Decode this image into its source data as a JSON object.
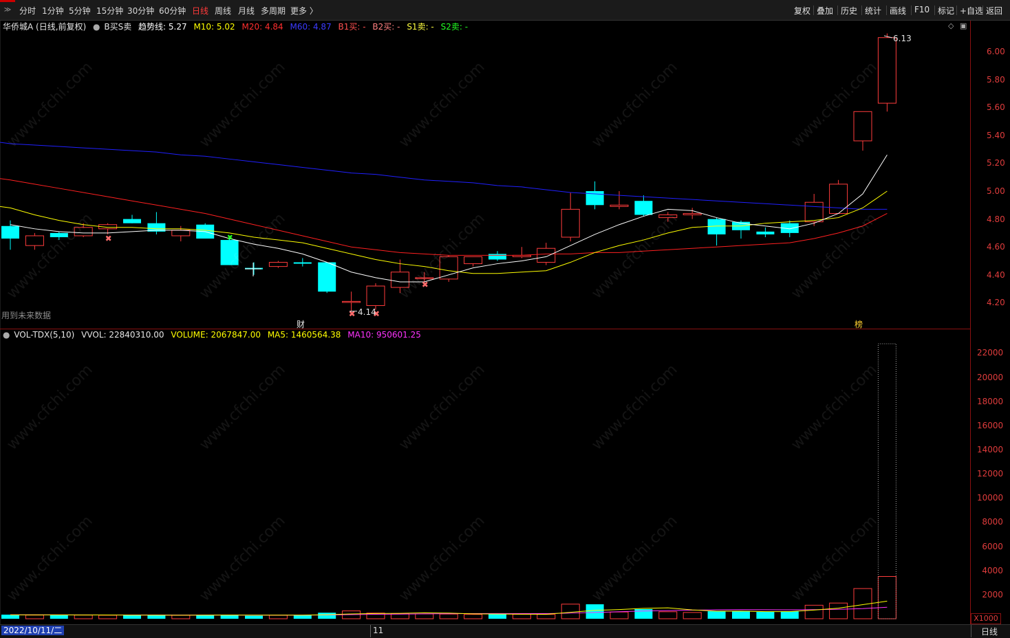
{
  "topbar": {
    "periods": [
      "分时",
      "1分钟",
      "5分钟",
      "15分钟",
      "30分钟",
      "60分钟",
      "日线",
      "周线",
      "月线",
      "多周期",
      "更多 〉"
    ],
    "active_period": "日线",
    "tools": [
      "复权",
      "叠加",
      "历史",
      "统计",
      "画线",
      "F10",
      "标记",
      "+自选",
      "返回"
    ]
  },
  "legend_main": {
    "stock": "华侨城A (日线,前复权)",
    "indicator": "B买S卖",
    "trend": "趋势线: 5.27",
    "m10": "M10: 5.02",
    "m20": "M20: 4.84",
    "m60": "M60: 4.87",
    "b1": "B1买: -",
    "b2": "B2买: -",
    "s1": "S1卖: -",
    "s2": "S2卖: -"
  },
  "legend_vol": {
    "name": "VOL-TDX(5,10)",
    "vvol": "VVOL: 22840310.00",
    "volume": "VOLUME: 2067847.00",
    "ma5": "MA5: 1460564.38",
    "ma10": "MA10: 950601.25"
  },
  "price_axis": [
    "6.00",
    "5.80",
    "5.60",
    "5.40",
    "5.20",
    "5.00",
    "4.80",
    "4.60",
    "4.40",
    "4.20"
  ],
  "vol_axis": [
    "22000",
    "20000",
    "18000",
    "16000",
    "14000",
    "12000",
    "10000",
    "8000",
    "6000",
    "4000",
    "2000"
  ],
  "vol_unit": "X1000",
  "annotations": {
    "high_label": "6.13",
    "low_label": "4.14",
    "cai_mark": "财",
    "bang_mark": "榜",
    "future_note": "用到未来数据"
  },
  "bottombar": {
    "date": "2022/10/11/二",
    "month": "11",
    "period_label": "日线"
  },
  "watermark": "www.cfchi.com",
  "colors": {
    "up": "#ff3c3c",
    "down": "#00ffff",
    "ma_trend": "#ffffff",
    "m10": "#ffff00",
    "m20": "#ff2020",
    "m60": "#2020ff",
    "ma5_vol": "#ffff00",
    "ma10_vol": "#ff33ff"
  },
  "chart_data": {
    "type": "candlestick",
    "candles": [
      {
        "o": 4.75,
        "h": 4.79,
        "l": 4.58,
        "c": 4.66
      },
      {
        "o": 4.61,
        "h": 4.7,
        "l": 4.58,
        "c": 4.68
      },
      {
        "o": 4.7,
        "h": 4.71,
        "l": 4.65,
        "c": 4.67
      },
      {
        "o": 4.68,
        "h": 4.77,
        "l": 4.67,
        "c": 4.74
      },
      {
        "o": 4.73,
        "h": 4.77,
        "l": 4.69,
        "c": 4.76
      },
      {
        "o": 4.8,
        "h": 4.83,
        "l": 4.77,
        "c": 4.77
      },
      {
        "o": 4.77,
        "h": 4.85,
        "l": 4.69,
        "c": 4.71
      },
      {
        "o": 4.68,
        "h": 4.75,
        "l": 4.64,
        "c": 4.72
      },
      {
        "o": 4.76,
        "h": 4.77,
        "l": 4.66,
        "c": 4.66
      },
      {
        "o": 4.65,
        "h": 4.68,
        "l": 4.47,
        "c": 4.47
      },
      {
        "o": 4.45,
        "h": 4.49,
        "l": 4.4,
        "c": 4.44
      },
      {
        "o": 4.46,
        "h": 4.5,
        "l": 4.45,
        "c": 4.49
      },
      {
        "o": 4.49,
        "h": 4.52,
        "l": 4.46,
        "c": 4.48
      },
      {
        "o": 4.49,
        "h": 4.49,
        "l": 4.27,
        "c": 4.28
      },
      {
        "o": 4.21,
        "h": 4.28,
        "l": 4.14,
        "c": 4.21
      },
      {
        "o": 4.18,
        "h": 4.34,
        "l": 4.15,
        "c": 4.32
      },
      {
        "o": 4.31,
        "h": 4.51,
        "l": 4.27,
        "c": 4.42
      },
      {
        "o": 4.38,
        "h": 4.42,
        "l": 4.35,
        "c": 4.38
      },
      {
        "o": 4.37,
        "h": 4.54,
        "l": 4.35,
        "c": 4.53
      },
      {
        "o": 4.48,
        "h": 4.53,
        "l": 4.46,
        "c": 4.53
      },
      {
        "o": 4.55,
        "h": 4.57,
        "l": 4.5,
        "c": 4.51
      },
      {
        "o": 4.53,
        "h": 4.6,
        "l": 4.52,
        "c": 4.54
      },
      {
        "o": 4.49,
        "h": 4.63,
        "l": 4.47,
        "c": 4.59
      },
      {
        "o": 4.67,
        "h": 4.99,
        "l": 4.64,
        "c": 4.87
      },
      {
        "o": 5.0,
        "h": 5.07,
        "l": 4.87,
        "c": 4.9
      },
      {
        "o": 4.89,
        "h": 5.0,
        "l": 4.87,
        "c": 4.9
      },
      {
        "o": 4.93,
        "h": 4.97,
        "l": 4.82,
        "c": 4.83
      },
      {
        "o": 4.81,
        "h": 4.85,
        "l": 4.78,
        "c": 4.83
      },
      {
        "o": 4.83,
        "h": 4.88,
        "l": 4.8,
        "c": 4.84
      },
      {
        "o": 4.8,
        "h": 4.81,
        "l": 4.61,
        "c": 4.69
      },
      {
        "o": 4.78,
        "h": 4.79,
        "l": 4.66,
        "c": 4.72
      },
      {
        "o": 4.71,
        "h": 4.74,
        "l": 4.67,
        "c": 4.69
      },
      {
        "o": 4.77,
        "h": 4.79,
        "l": 4.67,
        "c": 4.7
      },
      {
        "o": 4.78,
        "h": 4.98,
        "l": 4.75,
        "c": 4.92
      },
      {
        "o": 4.84,
        "h": 5.08,
        "l": 4.84,
        "c": 5.05
      },
      {
        "o": 5.36,
        "h": 5.57,
        "l": 5.29,
        "c": 5.57
      },
      {
        "o": 5.63,
        "h": 6.13,
        "l": 5.57,
        "c": 6.1
      }
    ],
    "ma_trend": [
      4.76,
      4.73,
      4.71,
      4.7,
      4.7,
      4.71,
      4.72,
      4.72,
      4.71,
      4.66,
      4.62,
      4.59,
      4.55,
      4.49,
      4.42,
      4.38,
      4.35,
      4.35,
      4.4,
      4.45,
      4.48,
      4.5,
      4.53,
      4.61,
      4.69,
      4.76,
      4.82,
      4.87,
      4.86,
      4.81,
      4.77,
      4.75,
      4.73,
      4.77,
      4.84,
      4.98,
      5.26
    ],
    "m10": [
      4.88,
      4.83,
      4.79,
      4.76,
      4.74,
      4.74,
      4.73,
      4.73,
      4.72,
      4.7,
      4.67,
      4.65,
      4.63,
      4.59,
      4.55,
      4.51,
      4.48,
      4.46,
      4.43,
      4.41,
      4.41,
      4.42,
      4.43,
      4.49,
      4.56,
      4.61,
      4.65,
      4.7,
      4.74,
      4.75,
      4.75,
      4.77,
      4.78,
      4.79,
      4.81,
      4.88,
      5.0
    ],
    "m20": [
      5.08,
      5.05,
      5.02,
      4.99,
      4.96,
      4.93,
      4.9,
      4.87,
      4.84,
      4.8,
      4.76,
      4.72,
      4.68,
      4.64,
      4.6,
      4.58,
      4.56,
      4.55,
      4.54,
      4.54,
      4.54,
      4.54,
      4.55,
      4.55,
      4.56,
      4.56,
      4.57,
      4.58,
      4.59,
      4.6,
      4.61,
      4.62,
      4.63,
      4.66,
      4.7,
      4.75,
      4.84
    ],
    "m60": [
      5.34,
      5.33,
      5.32,
      5.31,
      5.3,
      5.29,
      5.28,
      5.26,
      5.25,
      5.23,
      5.21,
      5.19,
      5.17,
      5.15,
      5.13,
      5.12,
      5.1,
      5.08,
      5.07,
      5.06,
      5.04,
      5.03,
      5.01,
      4.99,
      4.98,
      4.97,
      4.96,
      4.95,
      4.94,
      4.93,
      4.92,
      4.91,
      4.9,
      4.89,
      4.88,
      4.87,
      4.87
    ],
    "volume": [
      340,
      300,
      330,
      300,
      290,
      290,
      310,
      290,
      320,
      330,
      250,
      290,
      300,
      500,
      650,
      470,
      420,
      400,
      390,
      360,
      380,
      370,
      360,
      1210,
      1200,
      560,
      800,
      580,
      520,
      620,
      650,
      570,
      620,
      1120,
      1300,
      2500,
      3500
    ],
    "vol_ma5": [
      320,
      320,
      318,
      316,
      312,
      302,
      296,
      294,
      300,
      308,
      302,
      298,
      298,
      334,
      398,
      432,
      448,
      488,
      466,
      408,
      394,
      380,
      372,
      536,
      694,
      758,
      864,
      900,
      736,
      624,
      634,
      588,
      592,
      716,
      872,
      1164,
      1460
    ],
    "vol_ma10": [
      330,
      325,
      322,
      318,
      315,
      312,
      310,
      308,
      306,
      305,
      302,
      300,
      300,
      315,
      345,
      368,
      385,
      405,
      420,
      430,
      433,
      430,
      426,
      466,
      520,
      580,
      640,
      678,
      712,
      740,
      752,
      750,
      742,
      756,
      786,
      842,
      950
    ]
  }
}
